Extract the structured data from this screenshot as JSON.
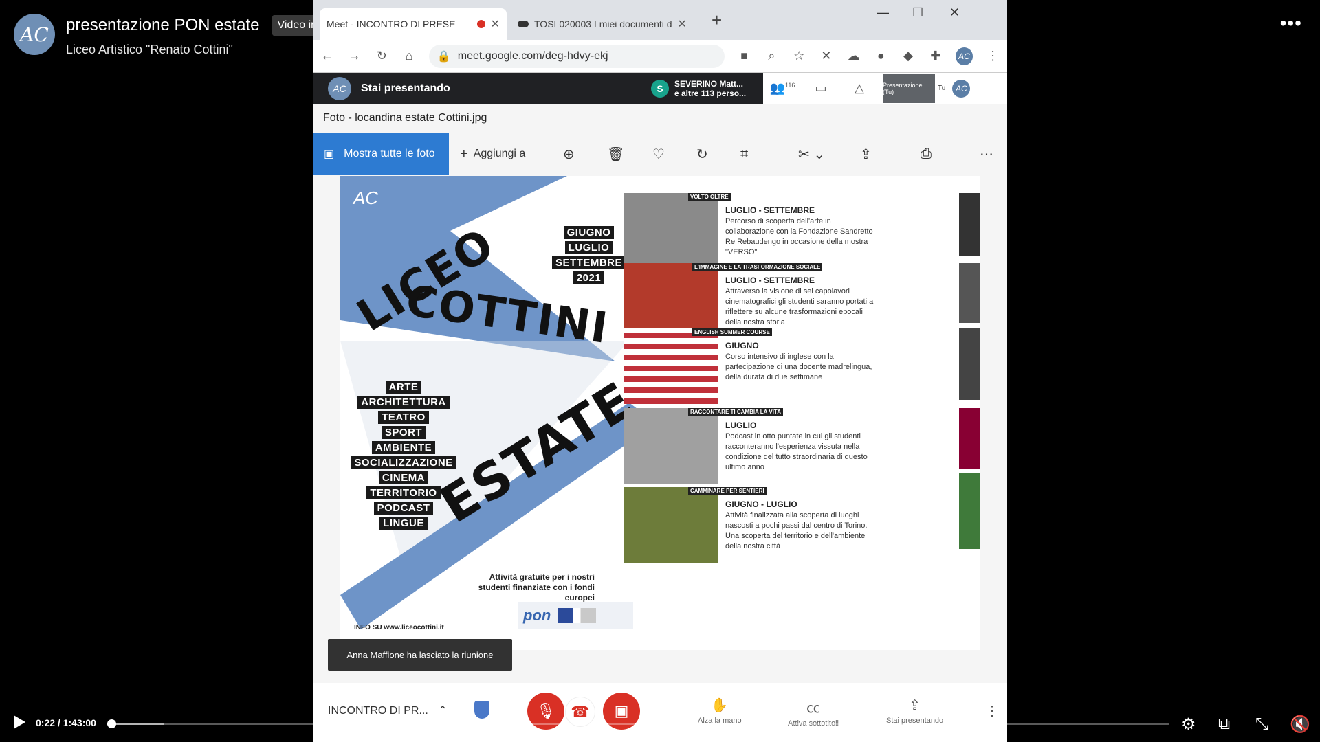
{
  "player": {
    "title": "presentazione PON estate",
    "live_badge": "Video in diretta registrato",
    "subtitle": "Liceo Artistico \"Renato Cottini\"",
    "more_label": "•••",
    "time": "0:22 / 1:43:00",
    "progress_fraction": 0.0036
  },
  "browser": {
    "tabs": [
      {
        "label": "Meet - INCONTRO DI PRESE",
        "recording": true
      },
      {
        "label": "TOSL020003 I miei documenti d"
      }
    ],
    "url": "meet.google.com/deg-hdvy-ekj"
  },
  "meet": {
    "presenting": "Stai presentando",
    "presenter_initial": "S",
    "presenter_line1": "SEVERINO Matt...",
    "presenter_line2": "e altre 113 perso...",
    "participants": "116",
    "thumb_label": "Presentazione (Tu)",
    "you_label": "Tu",
    "meeting_title": "INCONTRO DI PR...",
    "raise_hand": "Alza la mano",
    "captions": "Attiva sottotitoli",
    "presenting_btn": "Stai presentando"
  },
  "photos": {
    "window_title": "Foto - locandina estate Cottini.jpg",
    "show_all": "Mostra tutte le foto",
    "add_to": "Aggiungi a"
  },
  "poster": {
    "word1": "LICEO",
    "word2": "COTTINI",
    "word3": "ESTATE",
    "dates": [
      "GIUGNO",
      "LUGLIO",
      "SETTEMBRE",
      "2021"
    ],
    "subjects": [
      "ARTE",
      "ARCHITETTURA",
      "TEATRO",
      "SPORT",
      "AMBIENTE",
      "SOCIALIZZAZIONE",
      "CINEMA",
      "TERRITORIO",
      "PODCAST",
      "LINGUE"
    ],
    "free_text": "Attività gratuite per i nostri studenti finanziate con i fondi europei",
    "pon_logo": "pon",
    "info": "INFO SU www.liceocottini.it",
    "cards": [
      {
        "label": "VOLTO OLTRE",
        "heading": "LUGLIO - SETTEMBRE",
        "text": "Percorso di scoperta dell'arte in collaborazione con la Fondazione Sandretto Re Rebaudengo in occasione della mostra \"VERSO\"",
        "color": "#8a8a8a"
      },
      {
        "label": "L'IMMAGINE E LA TRASFORMAZIONE SOCIALE",
        "heading": "LUGLIO - SETTEMBRE",
        "text": "Attraverso la visione di sei capolavori cinematografici gli studenti saranno portati a riflettere su alcune trasformazioni epocali della nostra storia",
        "color": "#b33a2b"
      },
      {
        "label": "ENGLISH SUMMER COURSE",
        "heading": "GIUGNO",
        "text": "Corso intensivo di inglese con la partecipazione di una docente madrelingua, della durata di due settimane",
        "color": "#2b4a9a"
      },
      {
        "label": "RACCONTARE TI CAMBIA LA VITA",
        "heading": "LUGLIO",
        "text": "Podcast in otto puntate in cui gli studenti racconteranno l'esperienza vissuta nella condizione del tutto straordinaria di questo ultimo anno",
        "color": "#a0a0a0"
      },
      {
        "label": "CAMMINARE PER SENTIERI",
        "heading": "GIUGNO - LUGLIO",
        "text": "Attività finalizzata alla scoperta di luoghi nascosti a pochi passi dal centro di Torino. Una scoperta del territorio e dell'ambiente della nostra città",
        "color": "#6d7c3a"
      }
    ]
  },
  "toast": "Anna Maffione ha lasciato la riunione"
}
